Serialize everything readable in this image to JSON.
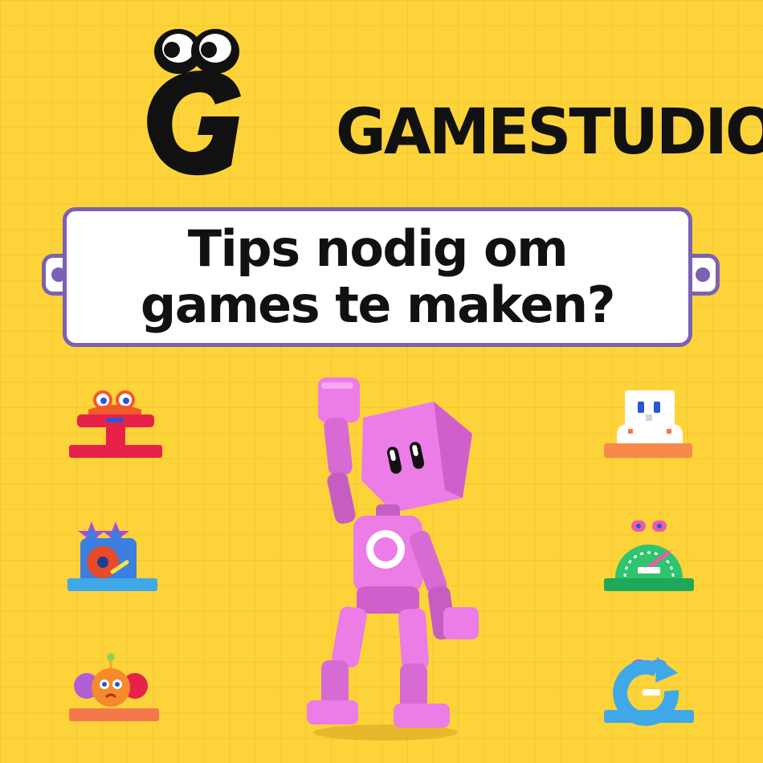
{
  "logo": {
    "text": "GAMESTUDIO",
    "icon": "googly-eyes-logo-icon"
  },
  "banner": {
    "line1": "Tips nodig om",
    "line2": "games te maken?"
  },
  "colors": {
    "background": "#fdd33a",
    "banner_border": "#7b61b3",
    "robot_pink": "#ec7ce6",
    "ink": "#111111"
  },
  "icons": {
    "left": [
      "red-pedestal-character-icon",
      "blue-dj-turntable-icon",
      "orange-clown-character-icon"
    ],
    "right": [
      "white-robot-character-icon",
      "green-speedometer-character-icon",
      "blue-refresh-character-icon"
    ],
    "center": "pink-robot-mascot-icon"
  }
}
